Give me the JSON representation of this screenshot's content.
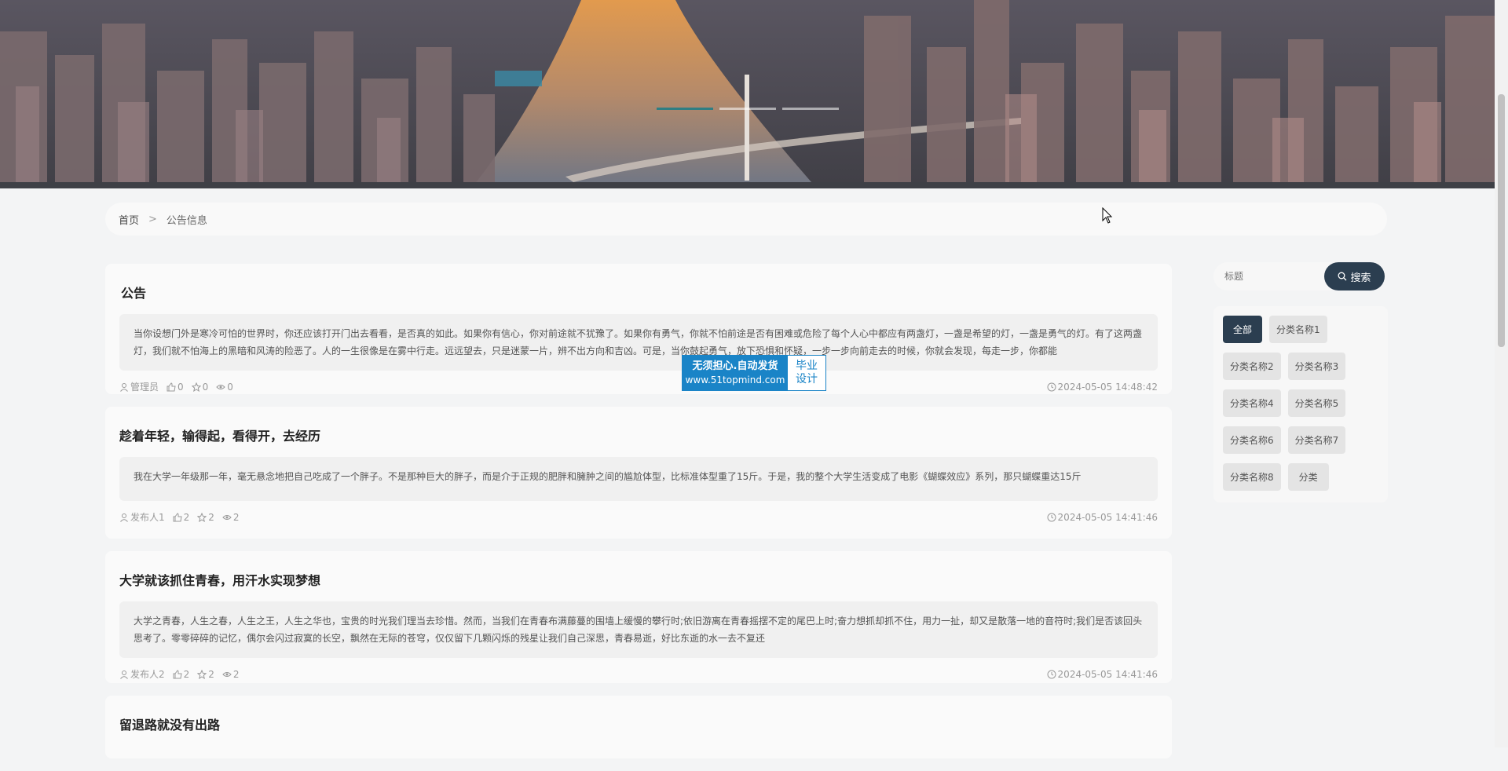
{
  "banner": {
    "dot_count": 3,
    "active_dot": 0
  },
  "breadcrumb": {
    "home": "首页",
    "separator": ">",
    "current": "公告信息"
  },
  "articles": [
    {
      "title": "公告",
      "summary": "当你设想门外是寒冷可怕的世界时，你还应该打开门出去看看，是否真的如此。如果你有信心，你对前途就不犹豫了。如果你有勇气，你就不怕前途是否有困难或危险了每个人心中都应有两盏灯，一盏是希望的灯，一盏是勇气的灯。有了这两盏灯，我们就不怕海上的黑暗和风涛的险恶了。人的一生很像是在雾中行走。远远望去，只是迷蒙一片，辨不出方向和吉凶。可是，当你鼓起勇气，放下恐惧和怀疑，一步一步向前走去的时候，你就会发现，每走一步，你都能",
      "author": "管理员",
      "likes": "0",
      "favorites": "0",
      "views": "0",
      "date": "2024-05-05 14:48:42"
    },
    {
      "title": "趁着年轻，输得起，看得开，去经历",
      "summary": "我在大学一年级那一年，毫无悬念地把自己吃成了一个胖子。不是那种巨大的胖子，而是介于正规的肥胖和臃肿之间的尴尬体型，比标准体型重了15斤。于是，我的整个大学生活变成了电影《蝴蝶效应》系列，那只蝴蝶重达15斤",
      "author": "发布人1",
      "likes": "2",
      "favorites": "2",
      "views": "2",
      "date": "2024-05-05 14:41:46"
    },
    {
      "title": "大学就该抓住青春，用汗水实现梦想",
      "summary": "大学之青春，人生之春，人生之王，人生之华也，宝贵的时光我们理当去珍惜。然而，当我们在青春布满藤蔓的围墙上缓慢的攀行时;依旧游离在青春摇摆不定的尾巴上时;奋力想抓却抓不住，用力一扯，却又是散落一地的音符时;我们是否该回头思考了。零零碎碎的记忆，偶尔会闪过寂寞的长空，飘然在无际的苍穹，仅仅留下几颗闪烁的残星让我们自己深思，青春易逝，好比东逝的水一去不复还",
      "author": "发布人2",
      "likes": "2",
      "favorites": "2",
      "views": "2",
      "date": "2024-05-05 14:41:46"
    },
    {
      "title": "留退路就没有出路",
      "summary": "",
      "author": "",
      "likes": "",
      "favorites": "",
      "views": "",
      "date": ""
    }
  ],
  "search": {
    "placeholder": "标题",
    "button_label": "搜索"
  },
  "categories": [
    "全部",
    "分类名称1",
    "分类名称2",
    "分类名称3",
    "分类名称4",
    "分类名称5",
    "分类名称6",
    "分类名称7",
    "分类名称8",
    "分类"
  ],
  "ad": {
    "line1": "无须担心.自动发货",
    "line2": "www.51topmind.com",
    "right1": "毕业",
    "right2": "设计"
  },
  "colors": {
    "primary": "#2b3e50",
    "accent_dot": "#2f7e83",
    "ad_blue": "#1a84c7"
  }
}
